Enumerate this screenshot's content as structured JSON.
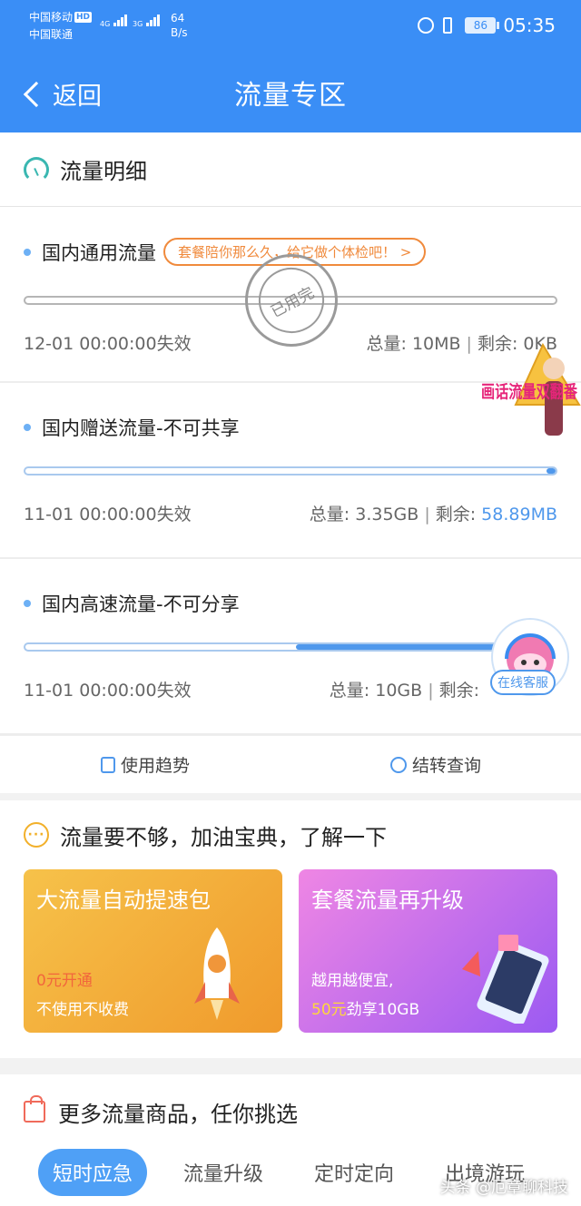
{
  "status": {
    "carrier1": "中国移动",
    "carrier1_badge": "HD",
    "carrier2": "中国联通",
    "net1": "4G",
    "net2": "3G",
    "speed_value": "64",
    "speed_unit": "B/s",
    "battery": "86",
    "time": "05:35"
  },
  "header": {
    "back_label": "返回",
    "title": "流量专区"
  },
  "usage": {
    "heading": "流量明细",
    "items": [
      {
        "name": "国内通用流量",
        "tag": "套餐陪你那么久，给它做个体检吧！ >",
        "stamp": "已用完",
        "expire": "12-01 00:00:00失效",
        "total": "总量: 10MB",
        "remain_label": "剩余:",
        "remain": "0KB",
        "remaining_fraction": 0
      },
      {
        "name": "国内赠送流量-不可共享",
        "expire": "11-01 00:00:00失效",
        "total": "总量: 3.35GB",
        "remain_label": "剩余:",
        "remain": "58.89MB",
        "remaining_fraction": 0.017
      },
      {
        "name": "国内高速流量-不可分享",
        "expire": "11-01 00:00:00失效",
        "total": "总量: 10GB",
        "remain_label": "剩余:",
        "remaining_fraction": 0.49
      }
    ],
    "actions": [
      "使用趋势",
      "结转查询"
    ]
  },
  "float_ad": {
    "text": "画话流量双翻番"
  },
  "service": {
    "label": "在线客服"
  },
  "promo": {
    "heading": "流量要不够，加油宝典，了解一下",
    "cards": [
      {
        "title": "大流量自动提速包",
        "line1": "0元开通",
        "line2": "不使用不收费"
      },
      {
        "title": "套餐流量再升级",
        "line1": "越用越便宜,",
        "line2_highlight": "50元",
        "line2_rest": "劲享10GB"
      }
    ]
  },
  "more": {
    "heading": "更多流量商品，任你挑选",
    "tabs": [
      "短时应急",
      "流量升级",
      "定时定向",
      "出境游玩"
    ]
  },
  "watermark": "头条 @厄章聊科技",
  "colors": {
    "brand": "#3a8ef6",
    "accent_orange": "#f08a3c",
    "bar_fill": "#4f98ec"
  }
}
